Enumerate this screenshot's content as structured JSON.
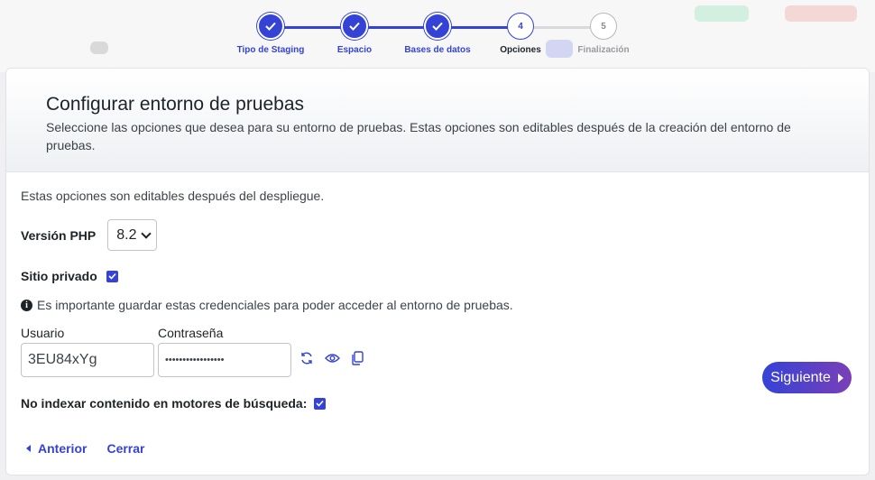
{
  "stepper": {
    "steps": [
      {
        "number": "1",
        "label": "Tipo de Staging",
        "state": "done"
      },
      {
        "number": "2",
        "label": "Espacio",
        "state": "done"
      },
      {
        "number": "3",
        "label": "Bases de datos",
        "state": "done"
      },
      {
        "number": "4",
        "label": "Opciones",
        "state": "current"
      },
      {
        "number": "5",
        "label": "Finalización",
        "state": "todo"
      }
    ]
  },
  "header": {
    "title": "Configurar entorno de pruebas",
    "subtitle": "Seleccione las opciones que desea para su entorno de pruebas. Estas opciones son editables después de la creación del entorno de pruebas."
  },
  "form": {
    "note": "Estas opciones son editables después del despliegue.",
    "php_label": "Versión PHP",
    "php_value": "8.2",
    "private_label": "Sitio privado",
    "private_checked": true,
    "info_text": "Es importante guardar estas credenciales para poder acceder al entorno de pruebas.",
    "user_label": "Usuario",
    "user_value": "3EU84xYg",
    "password_label": "Contraseña",
    "password_value": "•••••••••••••••••",
    "noindex_label": "No indexar contenido en motores de búsqueda:",
    "noindex_checked": true
  },
  "footer": {
    "prev_label": "Anterior",
    "close_label": "Cerrar",
    "next_label": "Siguiente"
  },
  "colors": {
    "accent": "#3443d6",
    "gradient_end": "#7a3fb8"
  },
  "icons": [
    "check-icon",
    "info-icon",
    "refresh-icon",
    "eye-icon",
    "copy-icon",
    "caret-left-icon",
    "caret-right-icon",
    "chevron-down-icon"
  ]
}
